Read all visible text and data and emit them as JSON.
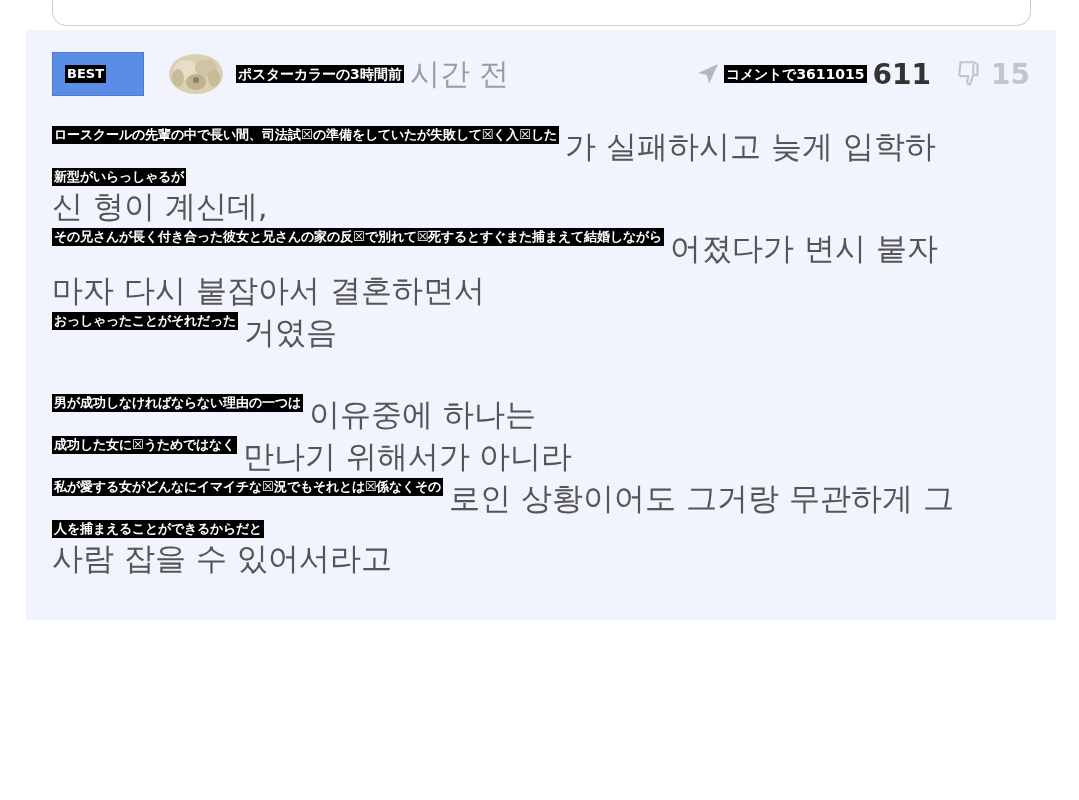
{
  "best_badge": {
    "overlay": "BEST"
  },
  "post_header": {
    "author_overlay": "ポスターカラーの3時間前",
    "time": "시간 전",
    "reply_overlay": "コメントで3611015",
    "likes": "611",
    "dislikes": "15"
  },
  "paragraphs": [
    [
      {
        "overlay": "ロースクールの先輩の中で長い間、司法試☒の準備をしていたが失敗して☒く入☒した",
        "text": "가 실패하시고 늦게 입학하"
      },
      {
        "overlay": "新型がいらっしゃるが"
      },
      {
        "text": "신 형이 계신데,"
      },
      {
        "overlay": "その兄さんが長く付き合った彼女と兄さんの家の反☒で別れて☒死するとすぐまた捕まえて結婚しながら",
        "text": "어졌다가 변시 붙자"
      },
      {
        "text": "마자 다시 붙잡아서 결혼하면서"
      },
      {
        "overlay": "おっしゃったことがそれだった",
        "text": "거였음"
      }
    ],
    [
      {
        "overlay": "男が成功しなければならない理由の一つは",
        "text": "이유중에 하나는"
      },
      {
        "overlay": "成功した女に☒うためではなく",
        "text": "만나기 위해서가 아니라"
      },
      {
        "overlay": "私が愛する女がどんなにイマイチな☒況でもそれとは☒係なくその",
        "text": "로인 상황이어도 그거랑 무관하게 그"
      },
      {
        "overlay": "人を捕まえることができるからだと"
      },
      {
        "text": "사람 잡을 수 있어서라고"
      }
    ]
  ]
}
